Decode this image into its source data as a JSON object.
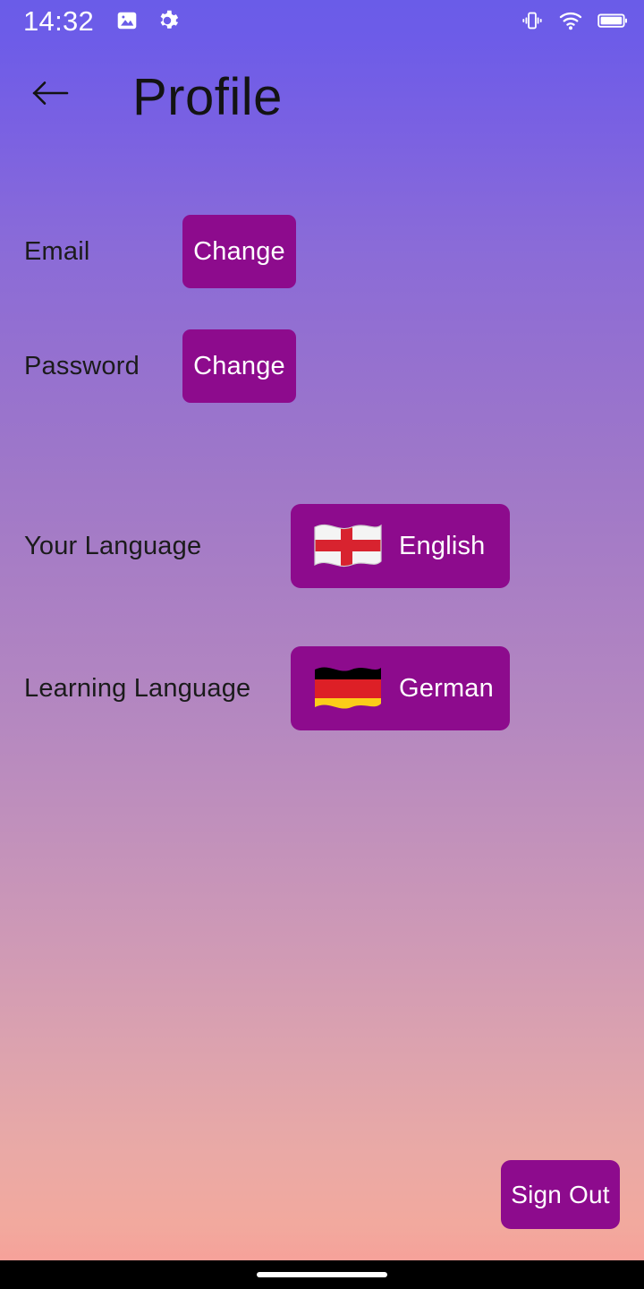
{
  "status_bar": {
    "time": "14:32",
    "left_icons": [
      "image-icon",
      "gear-icon"
    ],
    "right_icons": [
      "vibrate-icon",
      "wifi-icon",
      "battery-icon"
    ]
  },
  "app_bar": {
    "back_icon": "arrow-left-icon",
    "title": "Profile"
  },
  "rows": {
    "email": {
      "label": "Email",
      "button_label": "Change"
    },
    "password": {
      "label": "Password",
      "button_label": "Change"
    },
    "your_language": {
      "label": "Your Language",
      "value": "English",
      "flag_icon": "flag-england-icon"
    },
    "learning_language": {
      "label": "Learning Language",
      "value": "German",
      "flag_icon": "flag-germany-icon"
    }
  },
  "sign_out": {
    "label": "Sign Out"
  },
  "nav_bar": {
    "handle": "home-gesture-handle"
  },
  "colors": {
    "button_purple": "#8d0b8d",
    "gradient_top": "#6a5ce8",
    "gradient_bottom": "#f99b96",
    "label_text": "#1b1b1b",
    "button_text": "#ffffff",
    "status_text": "#ffffff",
    "nav_bar": "#000000"
  }
}
